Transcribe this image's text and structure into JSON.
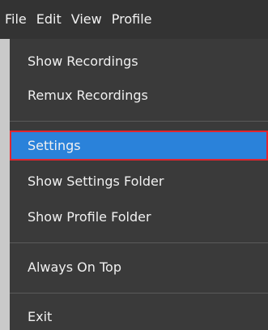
{
  "menubar": {
    "items": [
      {
        "label": "File"
      },
      {
        "label": "Edit"
      },
      {
        "label": "View"
      },
      {
        "label": "Profile"
      }
    ]
  },
  "file_menu": {
    "items": [
      {
        "label": "Show Recordings"
      },
      {
        "label": "Remux Recordings"
      },
      {
        "label": "Settings",
        "highlighted": true
      },
      {
        "label": "Show Settings Folder"
      },
      {
        "label": "Show Profile Folder"
      },
      {
        "label": "Always On Top"
      },
      {
        "label": "Exit"
      }
    ]
  },
  "colors": {
    "menubar_bg": "#333333",
    "menu_bg": "#3a3a3a",
    "highlight_bg": "#2a82da",
    "annotation_border": "#e0262e"
  }
}
